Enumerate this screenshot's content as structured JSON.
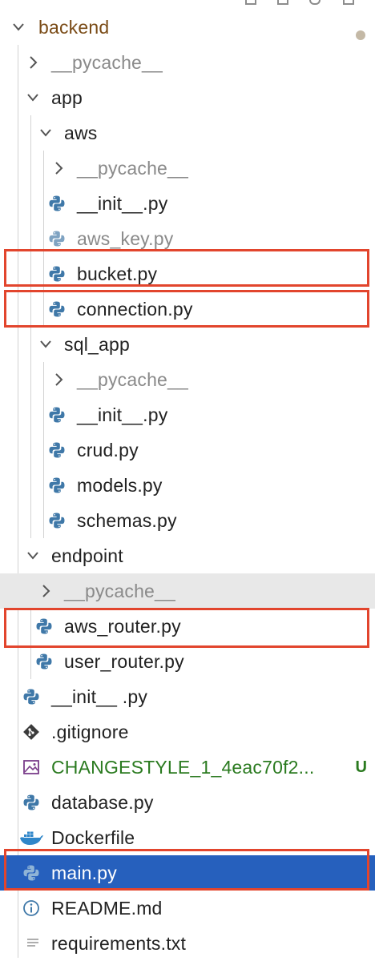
{
  "colors": {
    "selection": "#2660bd",
    "highlight_box": "#e2452d",
    "untracked_green": "#2a7a1f",
    "python_blue": "#3f78a8",
    "python_yellow": "#f1c232"
  },
  "tree": {
    "root": {
      "label": "backend",
      "icon": "chevron-down-icon",
      "status": "modified-dot-icon"
    },
    "items": [
      {
        "label": "__pycache__",
        "icon": "chevron-right-icon"
      },
      {
        "label": "app",
        "icon": "chevron-down-icon"
      },
      {
        "label": "aws",
        "icon": "chevron-down-icon"
      },
      {
        "label": "__pycache__",
        "icon": "chevron-right-icon"
      },
      {
        "label": "__init__.py",
        "icon": "python-icon"
      },
      {
        "label": "aws_key.py",
        "icon": "python-icon"
      },
      {
        "label": "bucket.py",
        "icon": "python-icon"
      },
      {
        "label": "connection.py",
        "icon": "python-icon"
      },
      {
        "label": "sql_app",
        "icon": "chevron-down-icon"
      },
      {
        "label": "__pycache__",
        "icon": "chevron-right-icon"
      },
      {
        "label": "__init__.py",
        "icon": "python-icon"
      },
      {
        "label": "crud.py",
        "icon": "python-icon"
      },
      {
        "label": "models.py",
        "icon": "python-icon"
      },
      {
        "label": "schemas.py",
        "icon": "python-icon"
      },
      {
        "label": "endpoint",
        "icon": "chevron-down-icon"
      },
      {
        "label": "__pycache__",
        "icon": "chevron-right-icon"
      },
      {
        "label": "aws_router.py",
        "icon": "python-icon"
      },
      {
        "label": "user_router.py",
        "icon": "python-icon"
      },
      {
        "label": "__init__ .py",
        "icon": "python-icon"
      },
      {
        "label": ".gitignore",
        "icon": "git-icon"
      },
      {
        "label": "CHANGESTYLE_1_4eac70f2...",
        "icon": "image-icon",
        "badge": "U"
      },
      {
        "label": "database.py",
        "icon": "python-icon"
      },
      {
        "label": "Dockerfile",
        "icon": "docker-icon"
      },
      {
        "label": "main.py",
        "icon": "python-icon",
        "selected": true
      },
      {
        "label": "README.md",
        "icon": "info-icon"
      },
      {
        "label": "requirements.txt",
        "icon": "text-file-icon"
      }
    ]
  }
}
